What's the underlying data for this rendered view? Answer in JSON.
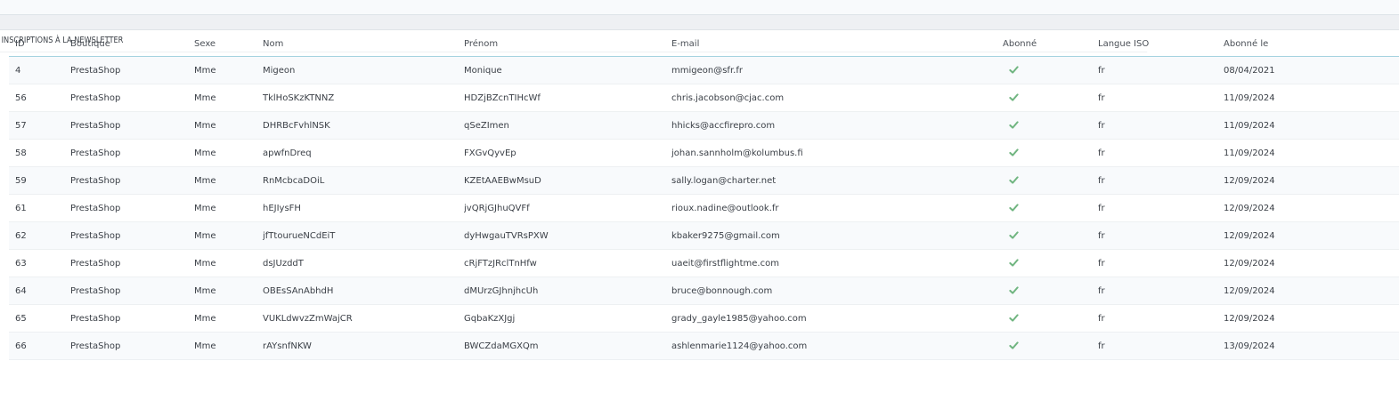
{
  "panel": {
    "title": "INSCRIPTIONS À LA NEWSLETTER"
  },
  "table": {
    "headers": {
      "id": "ID",
      "shop": "Boutique",
      "gender": "Sexe",
      "lastname": "Nom",
      "firstname": "Prénom",
      "email": "E-mail",
      "subscribed": "Abonné",
      "iso_lang": "Langue ISO",
      "subscribed_on": "Abonné le"
    },
    "rows": [
      {
        "id": "4",
        "shop": "PrestaShop",
        "gender": "Mme",
        "lastname": "Migeon",
        "firstname": "Monique",
        "email": "mmigeon@sfr.fr",
        "subscribed": "check-icon",
        "iso_lang": "fr",
        "subscribed_on": "08/04/2021"
      },
      {
        "id": "56",
        "shop": "PrestaShop",
        "gender": "Mme",
        "lastname": "TklHoSKzKTNNZ",
        "firstname": "HDZjBZcnTIHcWf",
        "email": "chris.jacobson@cjac.com",
        "subscribed": "check-icon",
        "iso_lang": "fr",
        "subscribed_on": "11/09/2024"
      },
      {
        "id": "57",
        "shop": "PrestaShop",
        "gender": "Mme",
        "lastname": "DHRBcFvhlNSK",
        "firstname": "qSeZImen",
        "email": "hhicks@accfirepro.com",
        "subscribed": "check-icon",
        "iso_lang": "fr",
        "subscribed_on": "11/09/2024"
      },
      {
        "id": "58",
        "shop": "PrestaShop",
        "gender": "Mme",
        "lastname": "apwfnDreq",
        "firstname": "FXGvQyvEp",
        "email": "johan.sannholm@kolumbus.fi",
        "subscribed": "check-icon",
        "iso_lang": "fr",
        "subscribed_on": "11/09/2024"
      },
      {
        "id": "59",
        "shop": "PrestaShop",
        "gender": "Mme",
        "lastname": "RnMcbcaDOiL",
        "firstname": "KZEtAAEBwMsuD",
        "email": "sally.logan@charter.net",
        "subscribed": "check-icon",
        "iso_lang": "fr",
        "subscribed_on": "12/09/2024"
      },
      {
        "id": "61",
        "shop": "PrestaShop",
        "gender": "Mme",
        "lastname": "hEJIysFH",
        "firstname": "jvQRjGJhuQVFf",
        "email": "rioux.nadine@outlook.fr",
        "subscribed": "check-icon",
        "iso_lang": "fr",
        "subscribed_on": "12/09/2024"
      },
      {
        "id": "62",
        "shop": "PrestaShop",
        "gender": "Mme",
        "lastname": "jfTtourueNCdEiT",
        "firstname": "dyHwgauTVRsPXW",
        "email": "kbaker9275@gmail.com",
        "subscribed": "check-icon",
        "iso_lang": "fr",
        "subscribed_on": "12/09/2024"
      },
      {
        "id": "63",
        "shop": "PrestaShop",
        "gender": "Mme",
        "lastname": "dsJUzddT",
        "firstname": "cRjFTzJRclTnHfw",
        "email": "uaeit@firstflightme.com",
        "subscribed": "check-icon",
        "iso_lang": "fr",
        "subscribed_on": "12/09/2024"
      },
      {
        "id": "64",
        "shop": "PrestaShop",
        "gender": "Mme",
        "lastname": "OBEsSAnAbhdH",
        "firstname": "dMUrzGJhnjhcUh",
        "email": "bruce@bonnough.com",
        "subscribed": "check-icon",
        "iso_lang": "fr",
        "subscribed_on": "12/09/2024"
      },
      {
        "id": "65",
        "shop": "PrestaShop",
        "gender": "Mme",
        "lastname": "VUKLdwvzZmWajCR",
        "firstname": "GqbaKzXJgj",
        "email": "grady_gayle1985@yahoo.com",
        "subscribed": "check-icon",
        "iso_lang": "fr",
        "subscribed_on": "12/09/2024"
      },
      {
        "id": "66",
        "shop": "PrestaShop",
        "gender": "Mme",
        "lastname": "rAYsnfNKW",
        "firstname": "BWCZdaMGXQm",
        "email": "ashlenmarie1124@yahoo.com",
        "subscribed": "check-icon",
        "iso_lang": "fr",
        "subscribed_on": "13/09/2024"
      }
    ]
  },
  "colors": {
    "check": "#70b580",
    "header_border": "#a6d3e0",
    "row_alt": "#f8fafc"
  }
}
